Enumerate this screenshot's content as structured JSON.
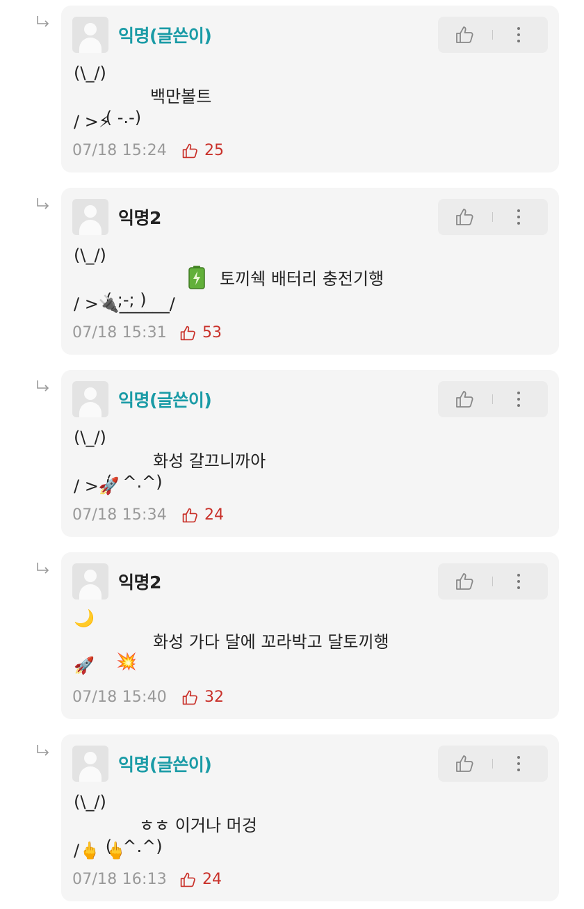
{
  "comments": [
    {
      "author": "익명(글쓴이)",
      "is_op": true,
      "lines": [
        "(\\_/)",
        "( -.-)",
        "/ >⚡"
      ],
      "message": "백만볼트",
      "time": "07/18 15:24",
      "likes": "25"
    },
    {
      "author": "익명2",
      "is_op": false,
      "lines": [
        "(\\_/)",
        "( ;-; )",
        "/ >🔌______/"
      ],
      "message": "토끼쉑 배터리 충전기행",
      "battery_icon": "battery-icon",
      "time": "07/18 15:31",
      "likes": "53"
    },
    {
      "author": "익명(글쓴이)",
      "is_op": true,
      "lines": [
        "(\\_/)",
        "(  ^.^)",
        "/ >🚀"
      ],
      "message": "화성 갈끄니까아",
      "time": "07/18 15:34",
      "likes": "24"
    },
    {
      "author": "익명2",
      "is_op": false,
      "lines": [
        "🌙",
        "  💥",
        "🚀"
      ],
      "message": "화성 가다 달에 꼬라박고 달토끼행",
      "time": "07/18 15:40",
      "likes": "32"
    },
    {
      "author": "익명(글쓴이)",
      "is_op": true,
      "lines": [
        "(\\_/)",
        "(  ^.^)",
        "/🖕 🖕"
      ],
      "message": "ㅎㅎ 이거나 머겅",
      "time": "07/18 16:13",
      "likes": "24"
    }
  ],
  "colors": {
    "op_author": "#1a9ba6",
    "likes": "#c9312a",
    "card_bg": "#f5f5f5"
  },
  "icons": {
    "reply": "reply-arrow-icon",
    "like": "thumbs-up-icon",
    "more": "more-vertical-icon"
  }
}
